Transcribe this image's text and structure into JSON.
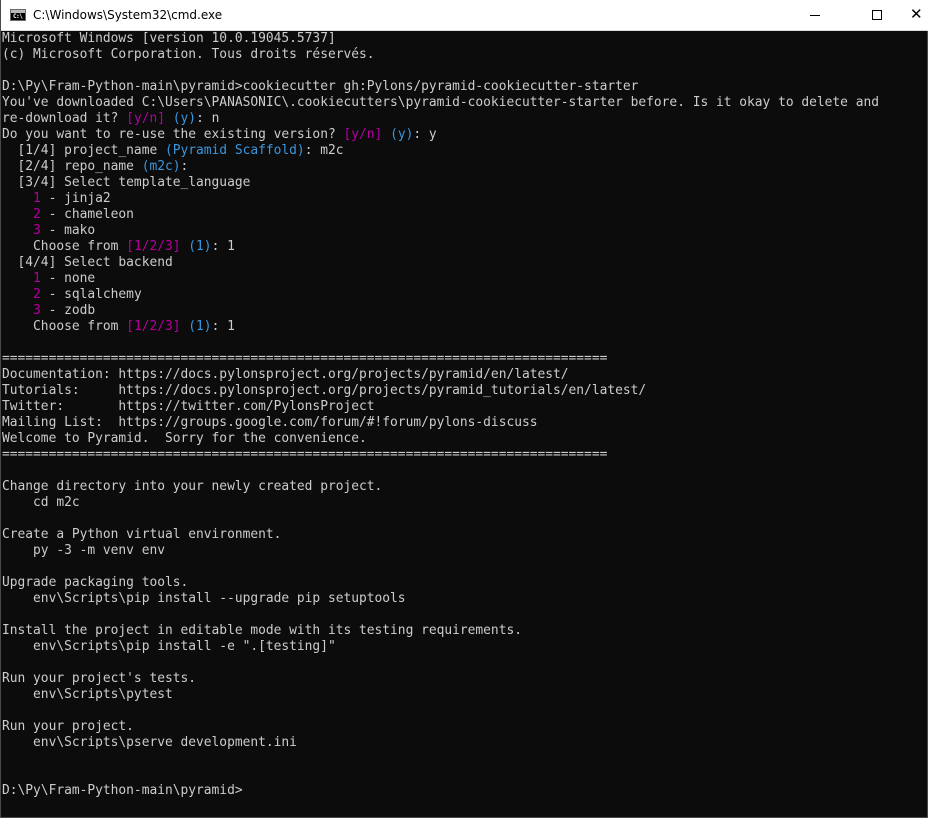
{
  "window": {
    "title": "C:\\Windows\\System32\\cmd.exe",
    "app_icon_glyph": "C:\\",
    "close_glyph": "✕",
    "colors": {
      "background": "#0c0c0c",
      "text": "#cccccc",
      "magenta": "#b4009e",
      "cyan": "#3a96dd",
      "titlebar": "#ffffff"
    }
  },
  "console": {
    "lines": [
      [
        {
          "t": "Microsoft Windows [version 10.0.19045.5737]"
        }
      ],
      [
        {
          "t": "(c) Microsoft Corporation. Tous droits réservés."
        }
      ],
      [],
      [
        {
          "t": "D:\\Py\\Fram-Python-main\\pyramid>cookiecutter gh:Pylons/pyramid-cookiecutter-starter"
        }
      ],
      [
        {
          "t": "You've downloaded C:\\Users\\PANASONIC\\.cookiecutters\\pyramid-cookiecutter-starter before. Is it okay to delete and"
        }
      ],
      [
        {
          "t": "re-download it? "
        },
        {
          "t": "[y/n]",
          "c": "magenta"
        },
        {
          "t": " "
        },
        {
          "t": "(y)",
          "c": "cyan"
        },
        {
          "t": ": n"
        }
      ],
      [
        {
          "t": "Do you want to re-use the existing version? "
        },
        {
          "t": "[y/n]",
          "c": "magenta"
        },
        {
          "t": " "
        },
        {
          "t": "(y)",
          "c": "cyan"
        },
        {
          "t": ": y"
        }
      ],
      [
        {
          "t": "  [1/4] project_name "
        },
        {
          "t": "(Pyramid Scaffold)",
          "c": "cyan"
        },
        {
          "t": ": m2c"
        }
      ],
      [
        {
          "t": "  [2/4] repo_name "
        },
        {
          "t": "(m2c)",
          "c": "cyan"
        },
        {
          "t": ":"
        }
      ],
      [
        {
          "t": "  [3/4] Select template_language"
        }
      ],
      [
        {
          "t": "    "
        },
        {
          "t": "1",
          "c": "magenta"
        },
        {
          "t": " - jinja2"
        }
      ],
      [
        {
          "t": "    "
        },
        {
          "t": "2",
          "c": "magenta"
        },
        {
          "t": " - chameleon"
        }
      ],
      [
        {
          "t": "    "
        },
        {
          "t": "3",
          "c": "magenta"
        },
        {
          "t": " - mako"
        }
      ],
      [
        {
          "t": "    Choose from "
        },
        {
          "t": "[1/2/3]",
          "c": "magenta"
        },
        {
          "t": " "
        },
        {
          "t": "(1)",
          "c": "cyan"
        },
        {
          "t": ": 1"
        }
      ],
      [
        {
          "t": "  [4/4] Select backend"
        }
      ],
      [
        {
          "t": "    "
        },
        {
          "t": "1",
          "c": "magenta"
        },
        {
          "t": " - none"
        }
      ],
      [
        {
          "t": "    "
        },
        {
          "t": "2",
          "c": "magenta"
        },
        {
          "t": " - sqlalchemy"
        }
      ],
      [
        {
          "t": "    "
        },
        {
          "t": "3",
          "c": "magenta"
        },
        {
          "t": " - zodb"
        }
      ],
      [
        {
          "t": "    Choose from "
        },
        {
          "t": "[1/2/3]",
          "c": "magenta"
        },
        {
          "t": " "
        },
        {
          "t": "(1)",
          "c": "cyan"
        },
        {
          "t": ": 1"
        }
      ],
      [],
      [
        {
          "t": "=============================================================================="
        }
      ],
      [
        {
          "t": "Documentation: https://docs.pylonsproject.org/projects/pyramid/en/latest/"
        }
      ],
      [
        {
          "t": "Tutorials:     https://docs.pylonsproject.org/projects/pyramid_tutorials/en/latest/"
        }
      ],
      [
        {
          "t": "Twitter:       https://twitter.com/PylonsProject"
        }
      ],
      [
        {
          "t": "Mailing List:  https://groups.google.com/forum/#!forum/pylons-discuss"
        }
      ],
      [
        {
          "t": "Welcome to Pyramid.  Sorry for the convenience."
        }
      ],
      [
        {
          "t": "=============================================================================="
        }
      ],
      [],
      [
        {
          "t": "Change directory into your newly created project."
        }
      ],
      [
        {
          "t": "    cd m2c"
        }
      ],
      [],
      [
        {
          "t": "Create a Python virtual environment."
        }
      ],
      [
        {
          "t": "    py -3 -m venv env"
        }
      ],
      [],
      [
        {
          "t": "Upgrade packaging tools."
        }
      ],
      [
        {
          "t": "    env\\Scripts\\pip install --upgrade pip setuptools"
        }
      ],
      [],
      [
        {
          "t": "Install the project in editable mode with its testing requirements."
        }
      ],
      [
        {
          "t": "    env\\Scripts\\pip install -e \".[testing]\""
        }
      ],
      [],
      [
        {
          "t": "Run your project's tests."
        }
      ],
      [
        {
          "t": "    env\\Scripts\\pytest"
        }
      ],
      [],
      [
        {
          "t": "Run your project."
        }
      ],
      [
        {
          "t": "    env\\Scripts\\pserve development.ini"
        }
      ],
      [],
      [],
      [
        {
          "t": "D:\\Py\\Fram-Python-main\\pyramid>"
        }
      ]
    ]
  }
}
